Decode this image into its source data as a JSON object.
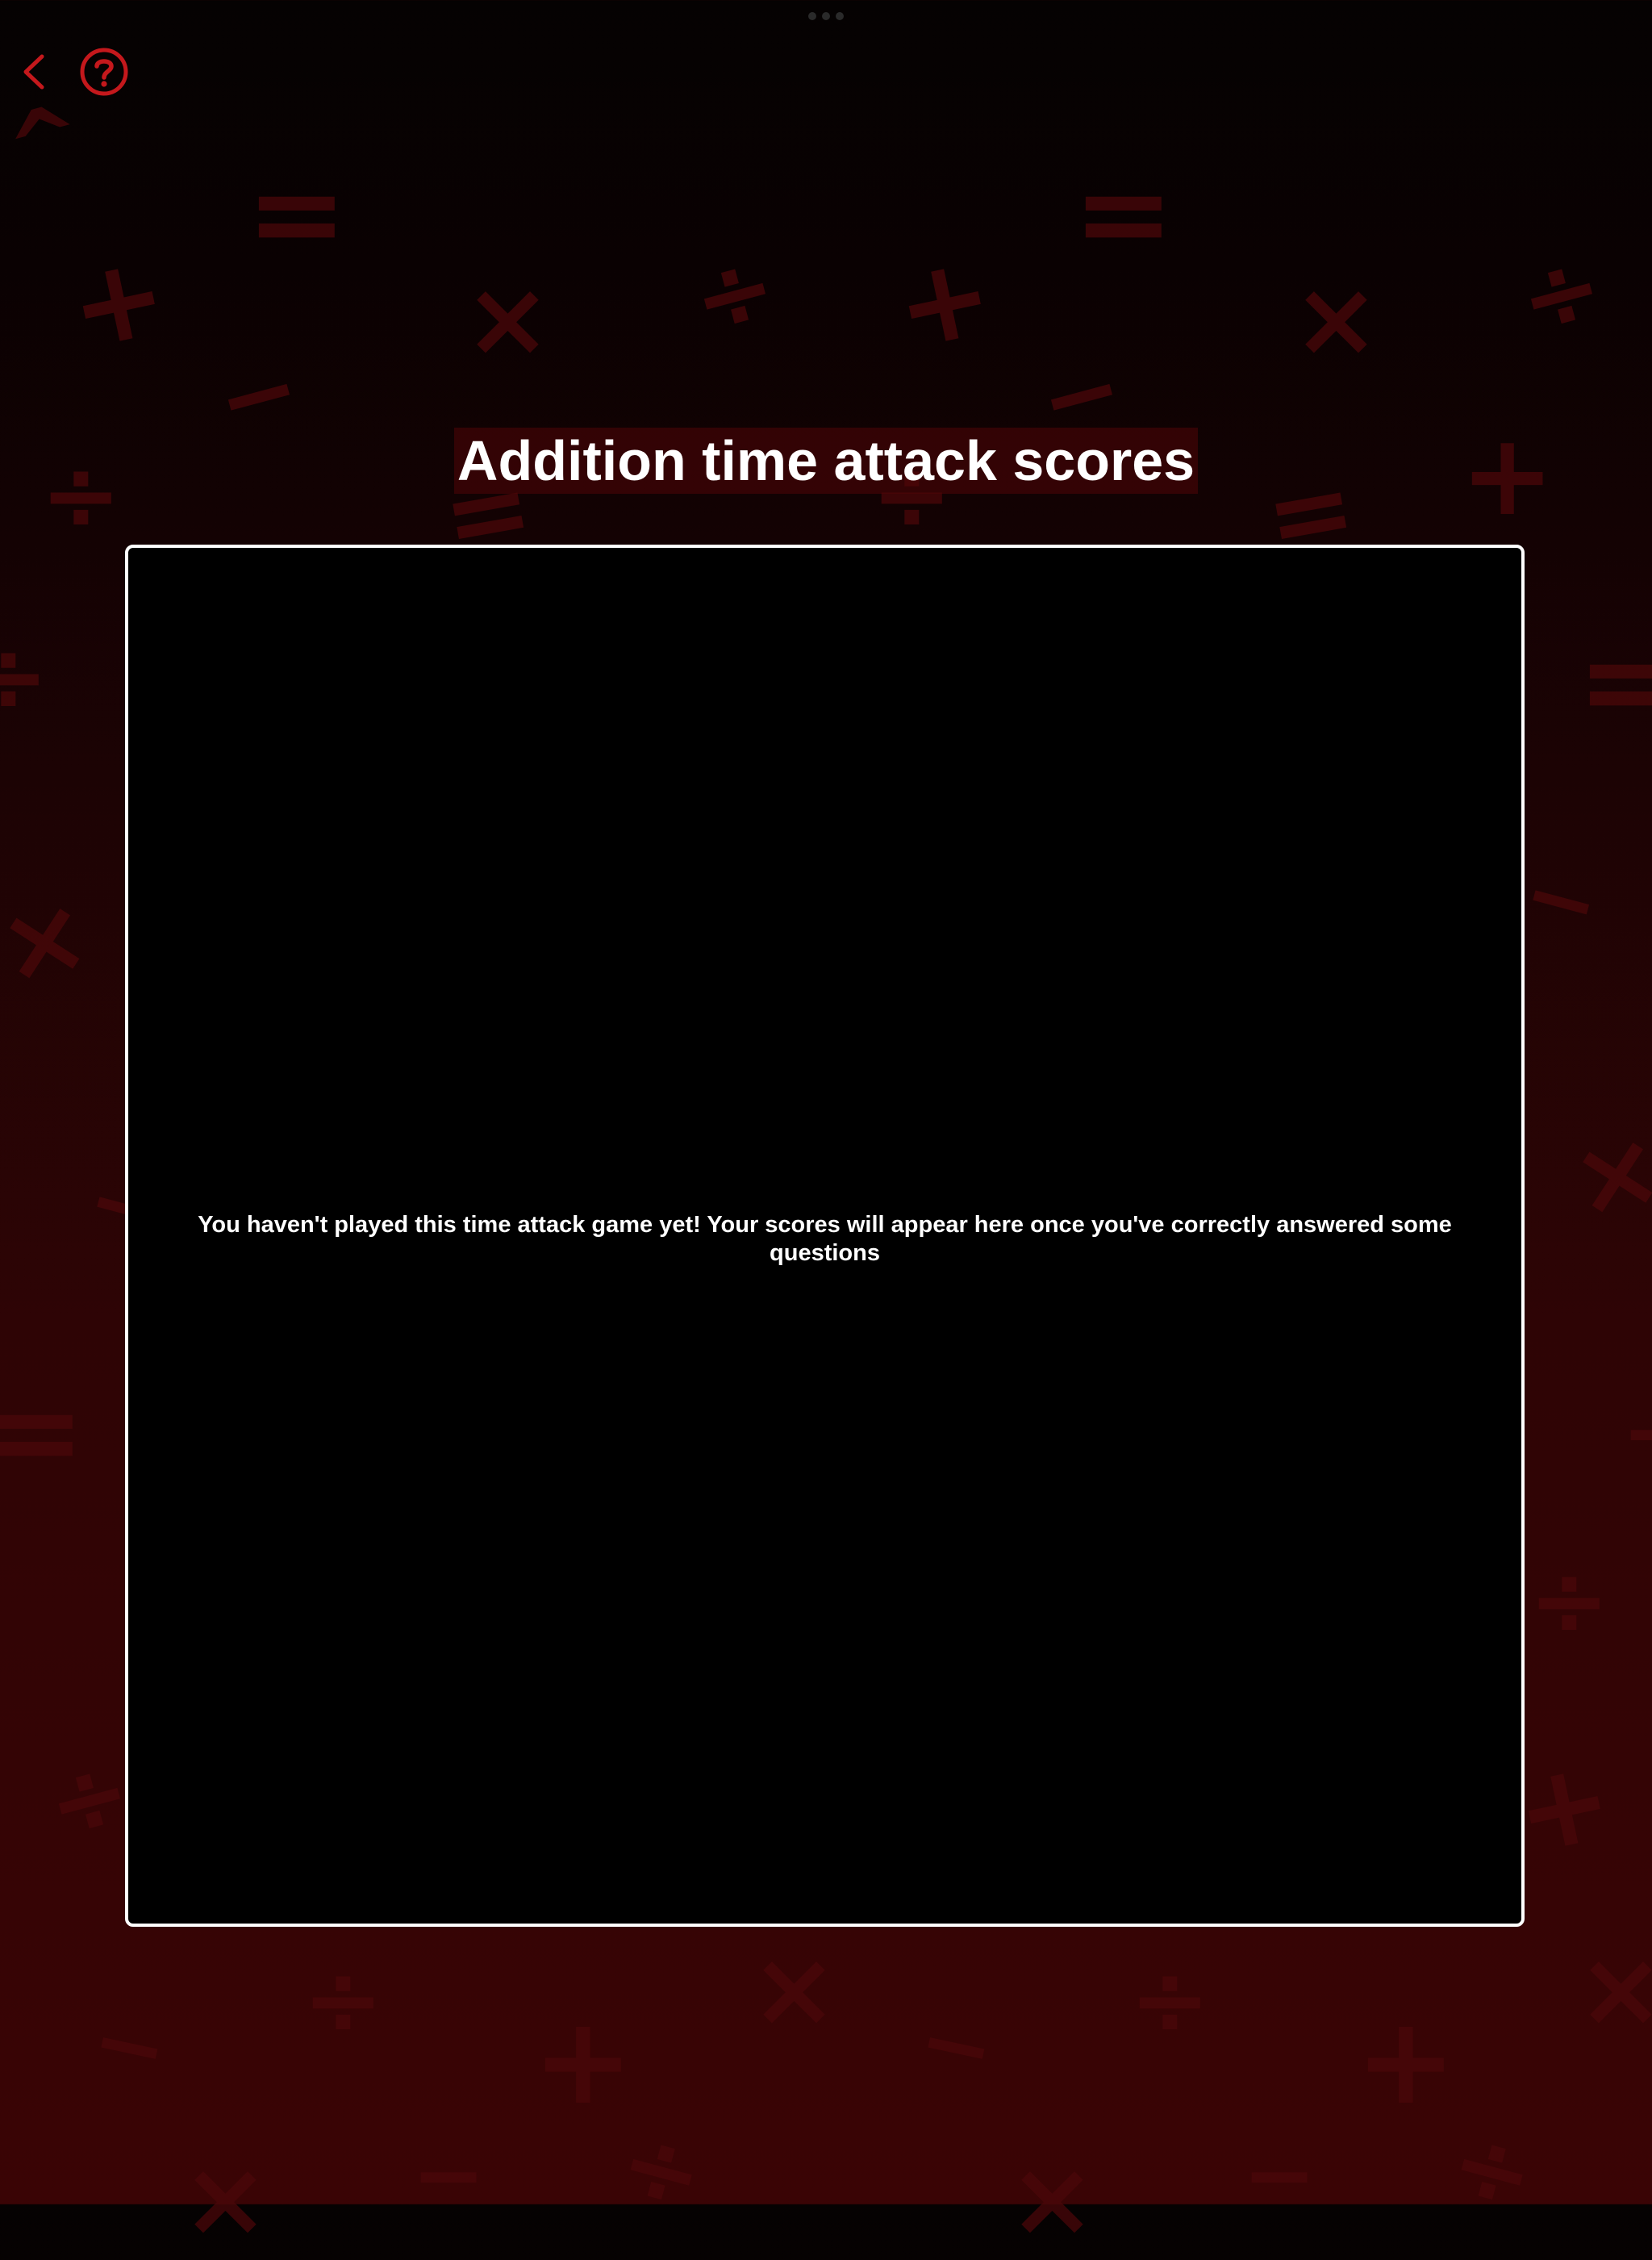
{
  "header": {
    "back_icon": "chevron-left-icon",
    "help_icon": "question-circle-icon",
    "accent_color": "#c4181c"
  },
  "page": {
    "title": "Addition time attack scores"
  },
  "scores_panel": {
    "empty_message": "You haven't played this time attack game yet! Your scores will appear here once you've correctly answered some questions"
  },
  "background": {
    "symbols": [
      "+",
      "−",
      "×",
      "÷",
      "="
    ],
    "symbol_color": "#4a0709"
  }
}
